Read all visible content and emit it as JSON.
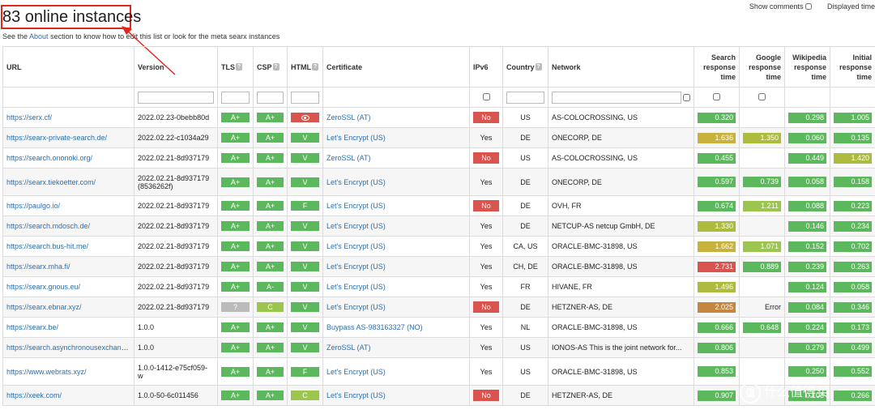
{
  "title": "83 online instances",
  "subtitle": {
    "pre": "See the ",
    "link": "About",
    "post": " section to know how to edit this list or look for the meta searx instances"
  },
  "options": {
    "show_comments": "Show comments",
    "displayed_time": "Displayed time"
  },
  "columns": {
    "url": "URL",
    "version": "Version",
    "tls": "TLS",
    "csp": "CSP",
    "html": "HTML",
    "certificate": "Certificate",
    "ipv6": "IPv6",
    "country": "Country",
    "network": "Network",
    "search": [
      "Search",
      "response",
      "time"
    ],
    "google": [
      "Google",
      "response",
      "time"
    ],
    "wikipedia": [
      "Wikipedia",
      "response",
      "time"
    ],
    "initial": [
      "Initial",
      "response",
      "time"
    ],
    "help_glyph": "?"
  },
  "colors": {
    "green": "#5cb85c",
    "lime": "#9bc54e",
    "olive": "#adbb3e",
    "mustard": "#c8b13c",
    "orange": "#c5873e",
    "red": "#d9534f",
    "gray": "#bbbbbb",
    "link": "#2a6fb3",
    "annotation": "#e0261f"
  },
  "rows": [
    {
      "url": "https://serx.cf/",
      "version": "2022.02.23-0bebb80d",
      "tls": "A+",
      "csp": "A+",
      "html": "eye",
      "cert": "ZeroSSL (AT)",
      "ipv6": "No",
      "country": "US",
      "network": "AS-COLOCROSSING, US",
      "search": {
        "v": "0.320",
        "c": "green"
      },
      "google": null,
      "wiki": {
        "v": "0.298",
        "c": "green"
      },
      "initial": {
        "v": "1.005",
        "c": "green"
      }
    },
    {
      "url": "https://searx-private-search.de/",
      "version": "2022.02.22-c1034a29",
      "tls": "A+",
      "csp": "A+",
      "html": "V",
      "cert": "Let's Encrypt (US)",
      "ipv6": "Yes",
      "country": "DE",
      "network": "ONECORP, DE",
      "search": {
        "v": "1.636",
        "c": "mustard"
      },
      "google": {
        "v": "1.350",
        "c": "olive"
      },
      "wiki": {
        "v": "0.060",
        "c": "green"
      },
      "initial": {
        "v": "0.135",
        "c": "green"
      }
    },
    {
      "url": "https://search.ononoki.org/",
      "version": "2022.02.21-8d937179",
      "tls": "A+",
      "csp": "A+",
      "html": "V",
      "cert": "ZeroSSL (AT)",
      "ipv6": "No",
      "country": "US",
      "network": "AS-COLOCROSSING, US",
      "search": {
        "v": "0.455",
        "c": "green"
      },
      "google": null,
      "wiki": {
        "v": "0.449",
        "c": "green"
      },
      "initial": {
        "v": "1.420",
        "c": "olive"
      }
    },
    {
      "url": "https://searx.tiekoetter.com/",
      "version": "2022.02.21-8d937179",
      "version2": "(8536262f)",
      "tls": "A+",
      "csp": "A+",
      "html": "V",
      "cert": "Let's Encrypt (US)",
      "ipv6": "Yes",
      "country": "DE",
      "network": "ONECORP, DE",
      "search": {
        "v": "0.597",
        "c": "green"
      },
      "google": {
        "v": "0.739",
        "c": "green"
      },
      "wiki": {
        "v": "0.058",
        "c": "green"
      },
      "initial": {
        "v": "0.158",
        "c": "green"
      }
    },
    {
      "url": "https://paulgo.io/",
      "version": "2022.02.21-8d937179",
      "tls": "A+",
      "csp": "A+",
      "html": "F",
      "cert": "Let's Encrypt (US)",
      "ipv6": "No",
      "country": "DE",
      "network": "OVH, FR",
      "search": {
        "v": "0.674",
        "c": "green"
      },
      "google": {
        "v": "1.211",
        "c": "lime"
      },
      "wiki": {
        "v": "0.088",
        "c": "green"
      },
      "initial": {
        "v": "0.223",
        "c": "green"
      }
    },
    {
      "url": "https://search.mdosch.de/",
      "version": "2022.02.21-8d937179",
      "tls": "A+",
      "csp": "A+",
      "html": "V",
      "cert": "Let's Encrypt (US)",
      "ipv6": "Yes",
      "country": "DE",
      "network": "NETCUP-AS netcup GmbH, DE",
      "search": {
        "v": "1.330",
        "c": "olive"
      },
      "google": null,
      "wiki": {
        "v": "0.146",
        "c": "green"
      },
      "initial": {
        "v": "0.234",
        "c": "green"
      }
    },
    {
      "url": "https://search.bus-hit.me/",
      "version": "2022.02.21-8d937179",
      "tls": "A+",
      "csp": "A+",
      "html": "V",
      "cert": "Let's Encrypt (US)",
      "ipv6": "Yes",
      "country": "CA, US",
      "network": "ORACLE-BMC-31898, US",
      "search": {
        "v": "1.662",
        "c": "mustard"
      },
      "google": {
        "v": "1.071",
        "c": "lime"
      },
      "wiki": {
        "v": "0.152",
        "c": "green"
      },
      "initial": {
        "v": "0.702",
        "c": "green"
      }
    },
    {
      "url": "https://searx.mha.fi/",
      "version": "2022.02.21-8d937179",
      "tls": "A+",
      "csp": "A+",
      "html": "V",
      "cert": "Let's Encrypt (US)",
      "ipv6": "Yes",
      "country": "CH, DE",
      "network": "ORACLE-BMC-31898, US",
      "search": {
        "v": "2.731",
        "c": "red"
      },
      "google": {
        "v": "0.889",
        "c": "green"
      },
      "wiki": {
        "v": "0.239",
        "c": "green"
      },
      "initial": {
        "v": "0.263",
        "c": "green"
      }
    },
    {
      "url": "https://searx.gnous.eu/",
      "version": "2022.02.21-8d937179",
      "tls": "A+",
      "csp": "A-",
      "html": "V",
      "cert": "Let's Encrypt (US)",
      "ipv6": "Yes",
      "country": "FR",
      "network": "HIVANE, FR",
      "search": {
        "v": "1.496",
        "c": "olive"
      },
      "google": null,
      "wiki": {
        "v": "0.124",
        "c": "green"
      },
      "initial": {
        "v": "0.058",
        "c": "green"
      }
    },
    {
      "url": "https://searx.ebnar.xyz/",
      "version": "2022.02.21-8d937179",
      "tls": "?",
      "csp": "C",
      "html": "V",
      "cert": "Let's Encrypt (US)",
      "ipv6": "No",
      "country": "DE",
      "network": "HETZNER-AS, DE",
      "search": {
        "v": "2.025",
        "c": "orange"
      },
      "google": {
        "v": "Error",
        "c": "plain"
      },
      "wiki": {
        "v": "0.084",
        "c": "green"
      },
      "initial": {
        "v": "0.346",
        "c": "green"
      }
    },
    {
      "url": "https://searx.be/",
      "version": "1.0.0",
      "tls": "A+",
      "csp": "A+",
      "html": "V",
      "cert": "Buypass AS-983163327 (NO)",
      "ipv6": "Yes",
      "country": "NL",
      "network": "ORACLE-BMC-31898, US",
      "search": {
        "v": "0.666",
        "c": "green"
      },
      "google": {
        "v": "0.648",
        "c": "green"
      },
      "wiki": {
        "v": "0.224",
        "c": "green"
      },
      "initial": {
        "v": "0.173",
        "c": "green"
      }
    },
    {
      "url": "https://search.asynchronousexchang...",
      "version": "1.0.0",
      "tls": "A+",
      "csp": "A+",
      "html": "V",
      "cert": "ZeroSSL (AT)",
      "ipv6": "Yes",
      "country": "US",
      "network": "IONOS-AS This is the joint network for...",
      "search": {
        "v": "0.806",
        "c": "green"
      },
      "google": null,
      "wiki": {
        "v": "0.279",
        "c": "green"
      },
      "initial": {
        "v": "0.499",
        "c": "green"
      }
    },
    {
      "url": "https://www.webrats.xyz/",
      "version": "1.0.0-1412-e75cf059-",
      "version2": "w",
      "tls": "A+",
      "csp": "A+",
      "html": "F",
      "cert": "Let's Encrypt (US)",
      "ipv6": "Yes",
      "country": "US",
      "network": "ORACLE-BMC-31898, US",
      "search": {
        "v": "0.853",
        "c": "green"
      },
      "google": null,
      "wiki": {
        "v": "0.250",
        "c": "green"
      },
      "initial": {
        "v": "0.552",
        "c": "green"
      }
    },
    {
      "url": "https://xeek.com/",
      "version": "1.0.0-50-6c011456",
      "tls": "A+",
      "csp": "A+",
      "html": "C",
      "cert": "Let's Encrypt (US)",
      "ipv6": "No",
      "country": "DE",
      "network": "HETZNER-AS, DE",
      "search": {
        "v": "0.907",
        "c": "green"
      },
      "google": null,
      "wiki": {
        "v": "0.103",
        "c": "green"
      },
      "initial": {
        "v": "0.266",
        "c": "green"
      }
    }
  ],
  "watermark": {
    "icon": "值",
    "text": "什么值得买"
  }
}
